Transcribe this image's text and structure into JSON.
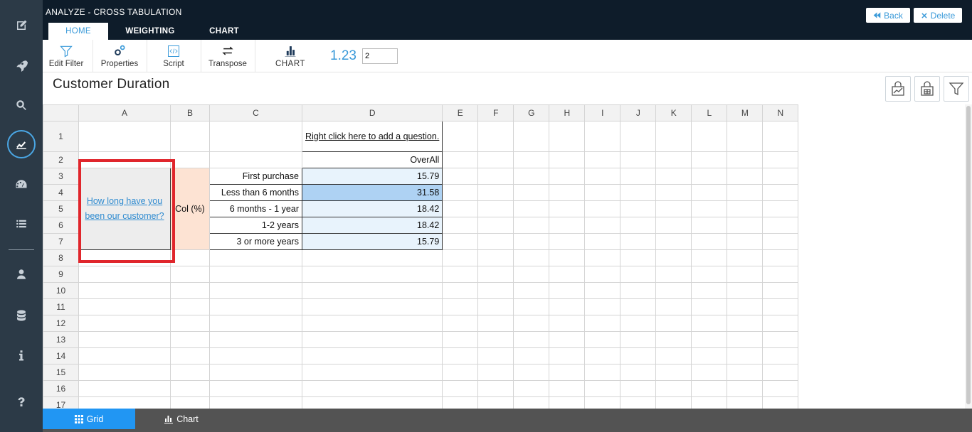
{
  "app": {
    "title": "ANALYZE - CROSS TABULATION"
  },
  "tabs": [
    {
      "label": "HOME",
      "active": true
    },
    {
      "label": "WEIGHTING",
      "active": false
    },
    {
      "label": "CHART",
      "active": false
    }
  ],
  "top_buttons": {
    "back": "Back",
    "delete": "Delete"
  },
  "ribbon": {
    "edit_filter": "Edit Filter",
    "properties": "Properties",
    "script": "Script",
    "transpose": "Transpose",
    "chart": "CHART",
    "decimals_label": "1.23",
    "decimals_value": "2"
  },
  "page_title": "Customer Duration",
  "sidebar_icons": [
    "edit-icon",
    "rocket-icon",
    "search-icon",
    "analytics-icon",
    "dashboard-icon",
    "list-icon",
    "user-icon",
    "database-icon",
    "info-icon",
    "help-icon"
  ],
  "grid": {
    "columns": [
      "A",
      "B",
      "C",
      "D",
      "E",
      "F",
      "G",
      "H",
      "I",
      "J",
      "K",
      "L",
      "M",
      "N"
    ],
    "rows": [
      "1",
      "2",
      "3",
      "4",
      "5",
      "6",
      "7",
      "8",
      "9",
      "10",
      "11",
      "12",
      "13",
      "14",
      "15",
      "16",
      "17"
    ],
    "add_question": "Right click here to add a question.",
    "overall": "OverAll",
    "question": "How long have you been our customer?",
    "col_pct": "Col (%)",
    "answers": [
      {
        "label": "First purchase",
        "value": "15.79"
      },
      {
        "label": "Less than 6 months",
        "value": "31.58"
      },
      {
        "label": "6 months - 1 year",
        "value": "18.42"
      },
      {
        "label": "1-2 years",
        "value": "18.42"
      },
      {
        "label": "3 or more years",
        "value": "15.79"
      }
    ]
  },
  "bottom_tabs": {
    "grid": "Grid",
    "chart": "Chart"
  },
  "colors": {
    "accent": "#3a9ad9",
    "highlight": "#aed2f3",
    "value_bg": "#e8f3fc",
    "annotation": "#e0262c"
  }
}
